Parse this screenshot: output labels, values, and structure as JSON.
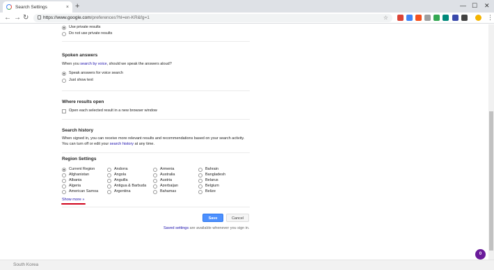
{
  "browser": {
    "tab_title": "Search Settings",
    "tab_close": "×",
    "new_tab": "+",
    "url_host": "https://www.google.com",
    "url_path": "/preferences?hl=en-KR&fg=1",
    "window": {
      "minimize": "—",
      "maximize": "☐",
      "close": "✕"
    },
    "nav": {
      "back": "←",
      "forward": "→",
      "reload": "↻"
    },
    "star": "☆",
    "menu": "⋮",
    "extensions": [
      {
        "icon": "red-extension-icon",
        "color": "#db4437"
      },
      {
        "icon": "blue-extension-icon",
        "color": "#4285f4"
      },
      {
        "icon": "orange-extension-icon",
        "color": "#f4511e"
      },
      {
        "icon": "gray-extension-icon",
        "color": "#9e9e9e"
      },
      {
        "icon": "green-extension-icon",
        "color": "#34a853"
      },
      {
        "icon": "teal-extension-icon",
        "color": "#00897b"
      },
      {
        "icon": "navy-extension-icon",
        "color": "#3949ab"
      },
      {
        "icon": "dark-extension-icon",
        "color": "#424242"
      }
    ]
  },
  "private_results": {
    "options": [
      "Use private results",
      "Do not use private results"
    ],
    "selected": 0
  },
  "spoken_answers": {
    "title": "Spoken answers",
    "desc_before": "When you ",
    "desc_link": "search by voice",
    "desc_after": ", should we speak the answers aloud?",
    "options": [
      "Speak answers for voice search",
      "Just show text"
    ],
    "selected": 0
  },
  "results_open": {
    "title": "Where results open",
    "checkbox_label": "Open each selected result in a new browser window"
  },
  "search_history": {
    "title": "Search history",
    "line1": "When signed in, you can receive more relevant results and recommendations based on your search activity.",
    "line2_before": "You can turn off or edit your ",
    "line2_link": "search history",
    "line2_after": " at any time."
  },
  "region_settings": {
    "title": "Region Settings",
    "columns": [
      [
        "Current Region",
        "Afghanistan",
        "Albania",
        "Algeria",
        "American Samoa"
      ],
      [
        "Andorra",
        "Angola",
        "Anguilla",
        "Antigua & Barbuda",
        "Argentina"
      ],
      [
        "Armenia",
        "Australia",
        "Austria",
        "Azerbaijan",
        "Bahamas"
      ],
      [
        "Bahrain",
        "Bangladesh",
        "Belarus",
        "Belgium",
        "Belize"
      ]
    ],
    "selected": "Current Region",
    "show_more": "Show more »"
  },
  "actions": {
    "save": "Save",
    "cancel": "Cancel",
    "saved_link": "Saved settings",
    "saved_rest": " are available whenever you sign in."
  },
  "footer": {
    "location": "South Korea"
  },
  "fab": {
    "label": "0",
    "color": "#6a1b9a"
  }
}
